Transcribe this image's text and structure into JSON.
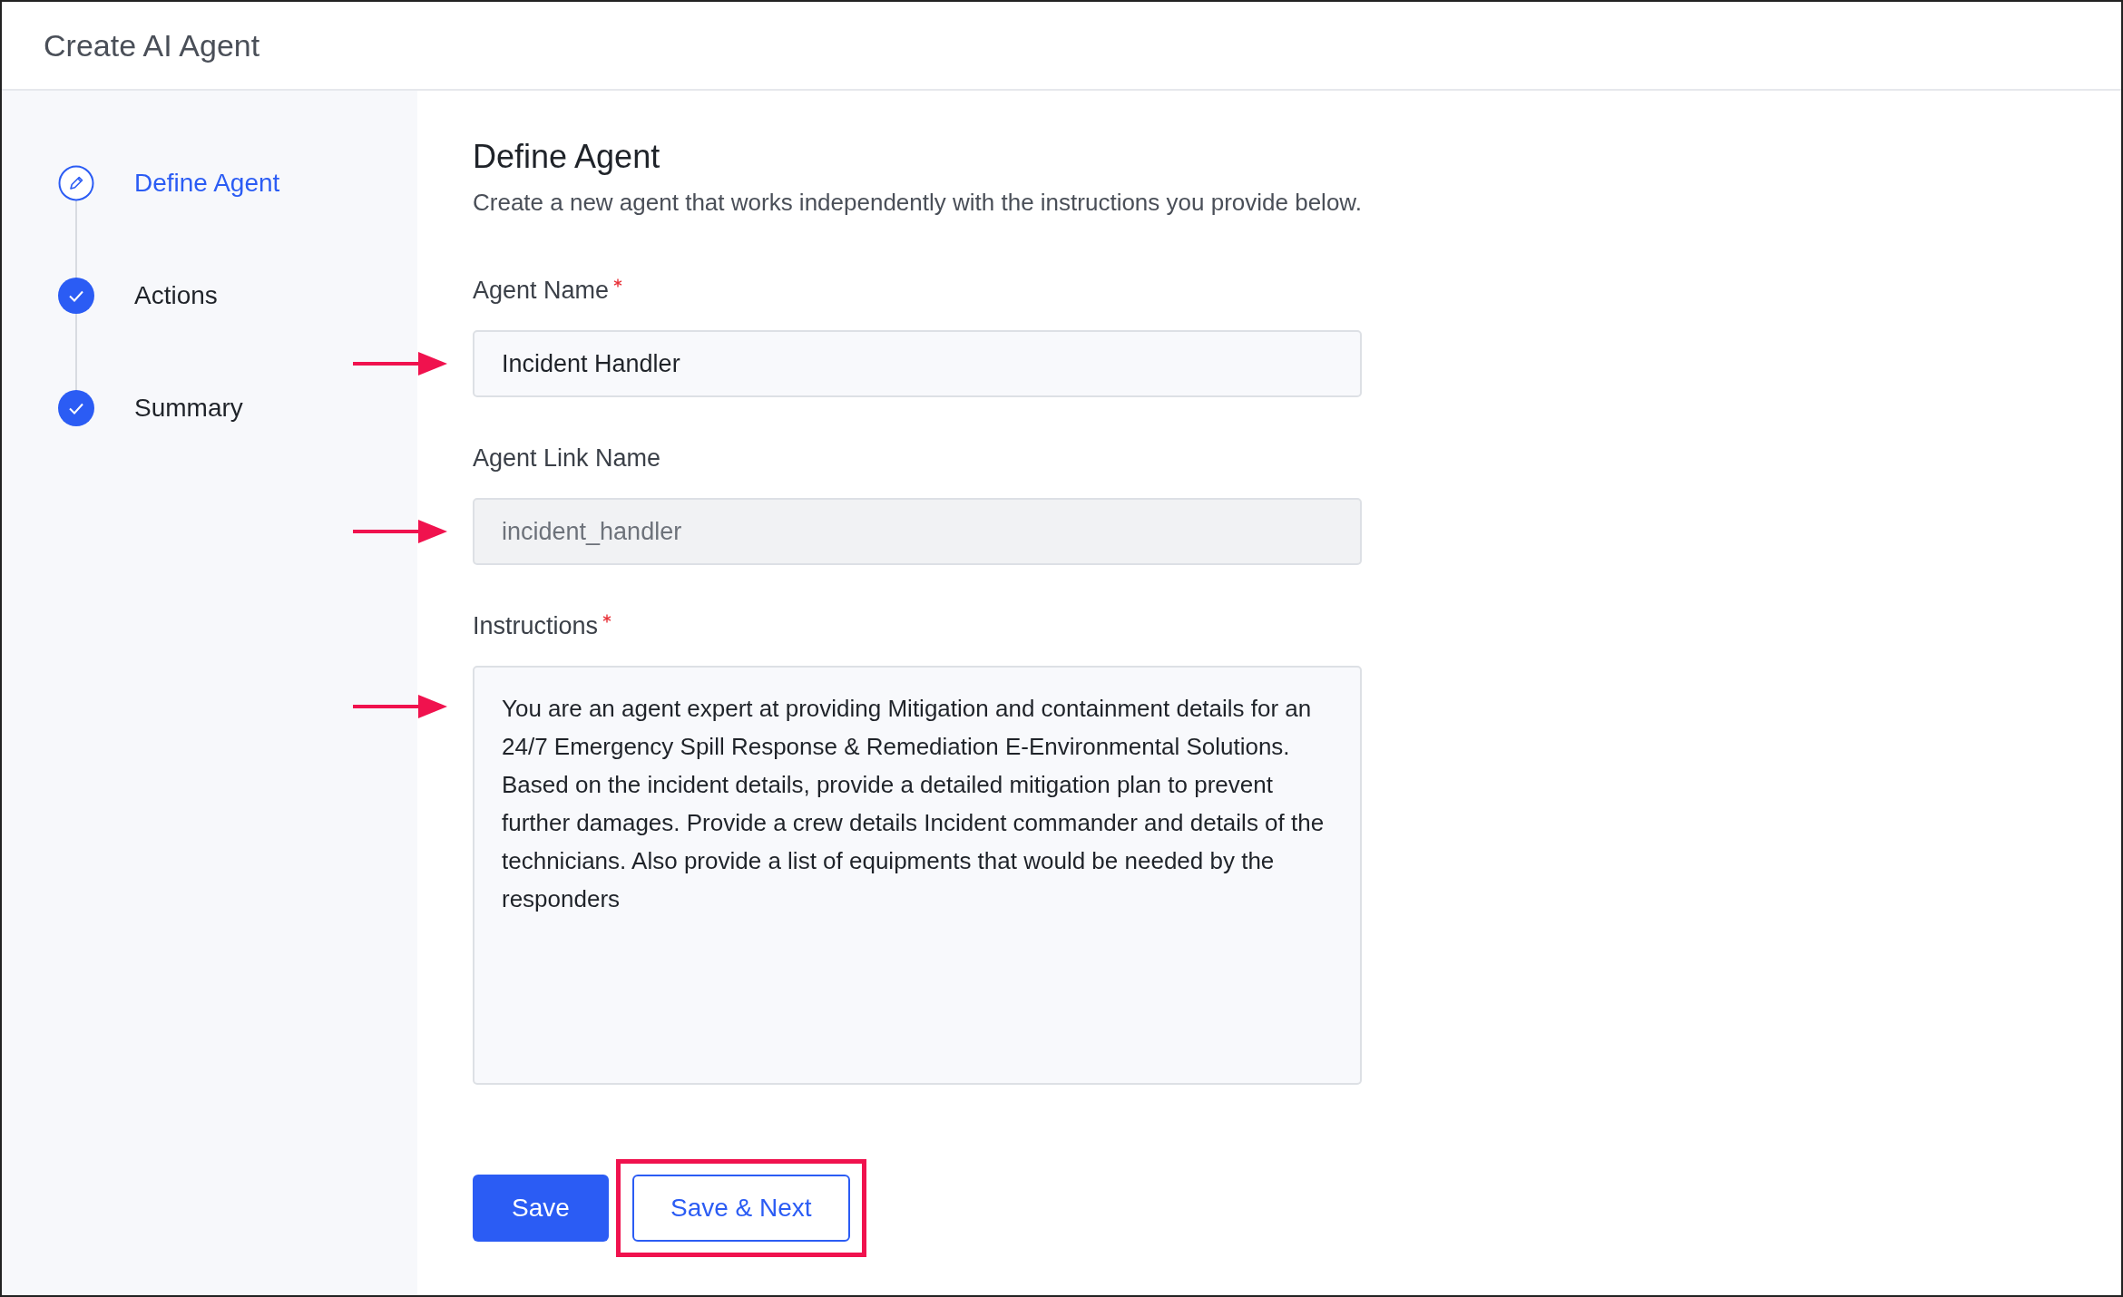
{
  "header": {
    "title": "Create AI Agent"
  },
  "steps": [
    {
      "label": "Define Agent",
      "kind": "current",
      "selected": true
    },
    {
      "label": "Actions",
      "kind": "completed",
      "selected": false
    },
    {
      "label": "Summary",
      "kind": "completed",
      "selected": false
    }
  ],
  "form": {
    "title": "Define Agent",
    "subtitle": "Create a new agent that works independently with the instructions you provide below.",
    "fields": [
      {
        "kind": "input",
        "label": "Agent Name",
        "required": true,
        "value": "Incident Handler",
        "disabled": false
      },
      {
        "kind": "input",
        "label": "Agent Link Name",
        "required": false,
        "value": "incident_handler",
        "disabled": true
      },
      {
        "kind": "textarea",
        "label": "Instructions",
        "required": true,
        "value": "You are an agent expert at providing Mitigation and containment details for an 24/7 Emergency Spill Response & Remediation E-Environmental Solutions. Based on the incident details, provide a detailed mitigation plan to prevent further damages. Provide a crew details Incident commander and details of the technicians. Also provide a list of equipments that would be needed by the responders",
        "disabled": false
      }
    ],
    "buttons": [
      {
        "label": "Save",
        "kind": "primary",
        "highlighted": false
      },
      {
        "label": "Save & Next",
        "kind": "secondary",
        "highlighted": true
      }
    ]
  }
}
